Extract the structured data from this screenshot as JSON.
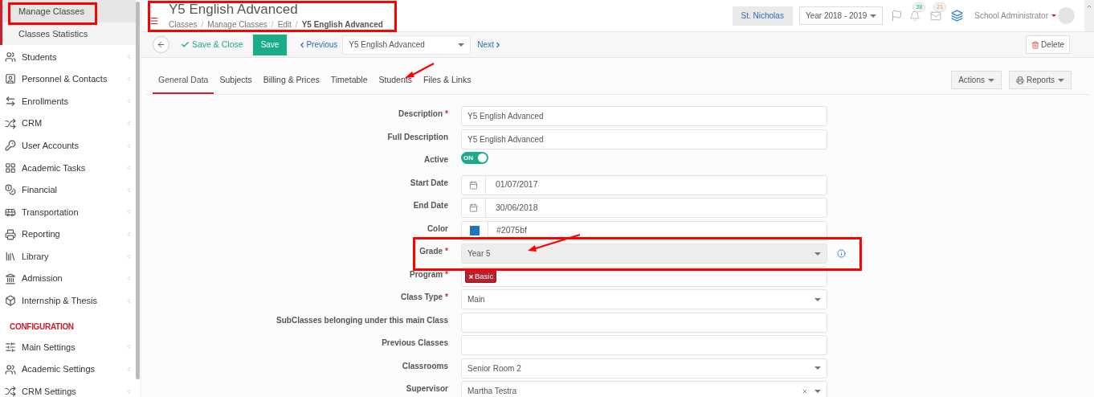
{
  "sidebar": {
    "subitems": [
      {
        "label": "Manage Classes",
        "selected": true
      },
      {
        "label": "Classes Statistics",
        "selected": false
      }
    ],
    "items": [
      {
        "label": "Students"
      },
      {
        "label": "Personnel & Contacts"
      },
      {
        "label": "Enrollments"
      },
      {
        "label": "CRM"
      },
      {
        "label": "User Accounts"
      },
      {
        "label": "Academic Tasks"
      },
      {
        "label": "Financial"
      },
      {
        "label": "Transportation"
      },
      {
        "label": "Reporting"
      },
      {
        "label": "Library"
      },
      {
        "label": "Admission"
      },
      {
        "label": "Internship & Thesis"
      }
    ],
    "section": "CONFIGURATION",
    "config_items": [
      {
        "label": "Main Settings"
      },
      {
        "label": "Academic Settings"
      },
      {
        "label": "CRM Settings"
      }
    ]
  },
  "required_mark": "*",
  "header": {
    "separator": "/",
    "title": "Y5 English Advanced",
    "breadcrumbs": [
      "Classes",
      "Manage Classes",
      "Edit",
      "Y5 English Advanced"
    ],
    "school": "St. Nicholas",
    "year": "Year 2018 - 2019",
    "notifications": "38",
    "messages": "21",
    "user": "School Administrator"
  },
  "toolbar": {
    "save_close": "Save & Close",
    "save": "Save",
    "previous": "Previous",
    "record": "Y5 English Advanced",
    "next": "Next",
    "delete": "Delete"
  },
  "tabs": [
    {
      "label": "General Data",
      "selected": true
    },
    {
      "label": "Subjects",
      "selected": false
    },
    {
      "label": "Billing & Prices",
      "selected": false
    },
    {
      "label": "Timetable",
      "selected": false
    },
    {
      "label": "Students",
      "selected": false
    },
    {
      "label": "Files & Links",
      "selected": false
    }
  ],
  "actions": [
    "Actions",
    "Reports"
  ],
  "form": [
    {
      "kind": "text",
      "label": "Description",
      "required": true,
      "value": "Y5 English Advanced"
    },
    {
      "kind": "text",
      "label": "Full Description",
      "required": false,
      "value": "Y5 English Advanced"
    },
    {
      "kind": "toggle",
      "label": "Active",
      "required": false,
      "on": true,
      "value": "ON"
    },
    {
      "kind": "date",
      "label": "Start Date",
      "required": false,
      "value": "01/07/2017"
    },
    {
      "kind": "date",
      "label": "End Date",
      "required": false,
      "value": "30/06/2018"
    },
    {
      "kind": "color",
      "label": "Color",
      "required": false,
      "value": "#2075bf",
      "color": "#2075bf"
    },
    {
      "kind": "select",
      "label": "Grade",
      "required": true,
      "value": "Year 5",
      "disabled": true,
      "info": true
    },
    {
      "kind": "tags",
      "label": "Program",
      "required": true,
      "tags": [
        "Basic"
      ]
    },
    {
      "kind": "select",
      "label": "Class Type",
      "required": true,
      "value": "Main",
      "disabled": false
    },
    {
      "kind": "text",
      "label": "SubClasses belonging under this main Class",
      "required": false
    },
    {
      "kind": "text",
      "label": "Previous Classes",
      "required": false
    },
    {
      "kind": "select",
      "label": "Classrooms",
      "required": false,
      "value": "Senior Room 2",
      "disabled": false
    },
    {
      "kind": "select",
      "label": "Supervisor",
      "required": false,
      "value": "Martha Testra",
      "disabled": false,
      "clearable": true
    }
  ]
}
